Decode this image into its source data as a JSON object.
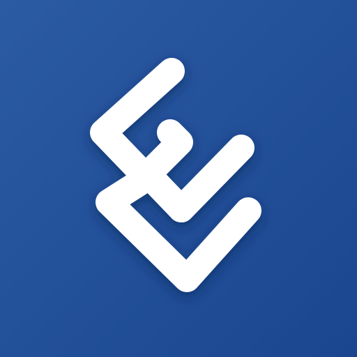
{
  "app_icon": {
    "icon": "stylized-e-logo-icon",
    "colors": {
      "background_start": "#2b5ba3",
      "background_end": "#1a468f",
      "mark": "#ffffff",
      "shadow": "#0b2250"
    }
  }
}
